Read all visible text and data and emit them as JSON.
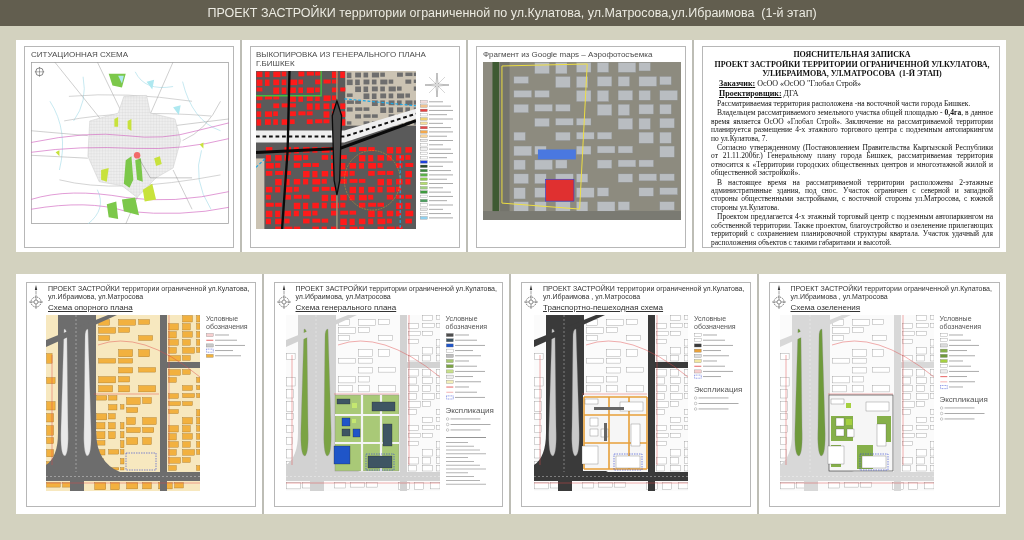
{
  "title_bar": {
    "title": "ПРОЕКТ ЗАСТРОЙКИ территории ограниченной по ул.Кулатова, ул.Матросова,ул.Ибраимова  (1-й этап)"
  },
  "top_sheets": [
    {
      "kind": "city-map",
      "caption": "СИТУАЦИОННАЯ СХЕМА"
    },
    {
      "kind": "master-plan",
      "caption": "ВЫКОПИРОВКА ИЗ ГЕНЕРАЛЬНОГО ПЛАНА Г.БИШКЕК"
    },
    {
      "kind": "aerial-photo",
      "caption": "Фрагмент из Google maps – Аэрофотосъемка"
    },
    {
      "kind": "note",
      "heading": "ПОЯСНИТЕЛЬНАЯ ЗАПИСКА",
      "subheading": "ПРОЕКТ ЗАСТРОЙКИ ТЕРРИТОРИИ ОГРАНИЧЕННОЙ УЛ.КУЛАТОВА, УЛ.ИБРАИМОВА, УЛ.МАТРОСОВА  (1-Й ЭТАП)",
      "fields": [
        {
          "label": "Заказчик:",
          "value": "ОсОО «ОсОО \"Глобал Строй»"
        },
        {
          "label": "Проектировщик:",
          "value": "ДГА"
        }
      ],
      "paragraphs": [
        "Рассматриваемая территория расположена -на восточной части города Бишкек.",
        "Владельцем рассматриваемого земельного участка общей площадью - **0,4га**, в данное время является ОсОО «Глобал Строй». Заключение на рассматриваемой территории планируется размещение 4-х этажного торгового центра с подземным автопаркингом по ул.Кулатова, 7.",
        "Согласно утвержденному (Постановлением Правительства Кыргызской Республики от 21.11.2006г.) Генеральному плану города Бишкек, рассматриваемая территория относится к «Территории городских общественных центров и многоэтажной жилой и общественной застройкой».",
        "В настоящее время на рассматриваемой территории расположены 2-этажные административные здания, под снос. Участок ограничен с северной и западной стороны общественными застройками, с восточной стороны ул.Матросова, с южной стороны ул.Кулатова.",
        "Проектом предлагается 4-х этажный торговый центр с подземным автопаркингом на собственной территории. Также проектом, благоустройство и озеленение прилегающих территорий с сохранением планировочной структуры квартала. Участок удачный для расположения объектов с такими габаритами и высотой."
      ]
    }
  ],
  "bottom_sheets": [
    {
      "kind": "base-plan",
      "title": "ПРОЕКТ ЗАСТРОЙКИ территории ограниченной ул.Кулатова, ул.Ибраимова, ул.Матросова",
      "subtitle": "Схема опорного плана",
      "legend_title": "Условные обозначения"
    },
    {
      "kind": "general-plan",
      "title": "ПРОЕКТ ЗАСТРОЙКИ территории ограниченной ул.Кулатова, ул.Ибраимова, ул.Матросова",
      "subtitle": "Схема генерального плана",
      "legend_title": "Условные обозначения",
      "explication_title": "Экспликация"
    },
    {
      "kind": "transport-plan",
      "title": "ПРОЕКТ ЗАСТРОЙКИ территории ограниченной ул.Кулатова, ул.Ибраимова , ул.Матросова",
      "subtitle": "Транспортно-пешеходная схема",
      "legend_title": "Условные обозначения",
      "explication_title": "Экспликация"
    },
    {
      "kind": "landscaping-plan",
      "title": "ПРОЕКТ ЗАСТРОЙКИ территории ограниченной ул.Кулатова, ул.Ибраимова , ул.Матросова",
      "subtitle": "Схема озеленения",
      "legend_title": "Условные обозначения",
      "explication_title": "Экспликация"
    }
  ]
}
